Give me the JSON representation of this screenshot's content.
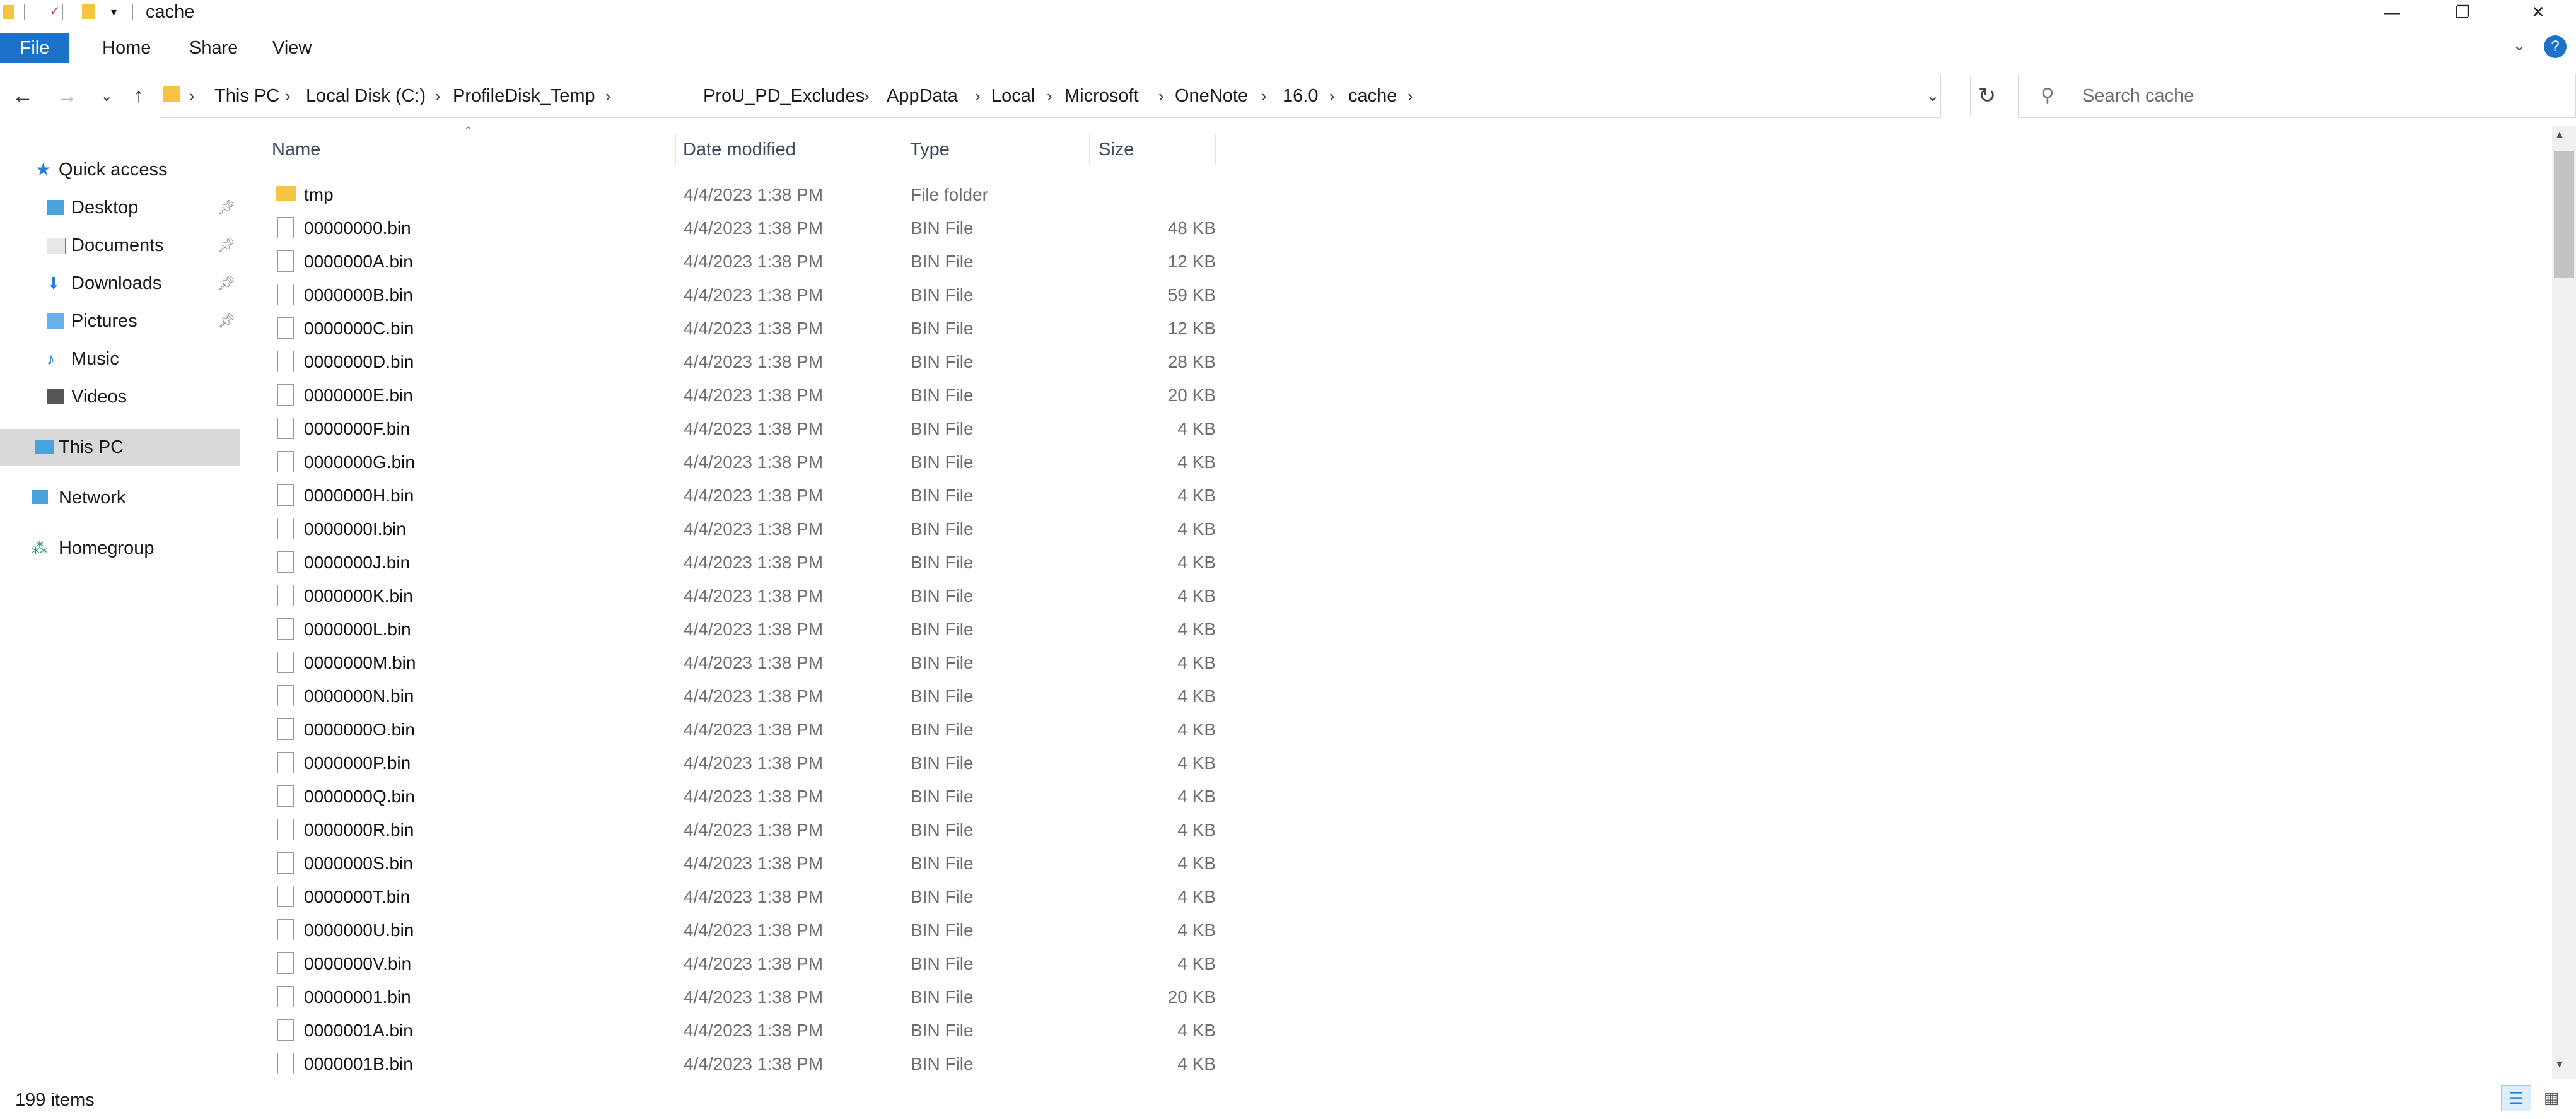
{
  "window": {
    "title": "cache",
    "minimize_icon": "minimize-icon",
    "restore_icon": "restore-icon",
    "close_icon": "close-icon"
  },
  "ribbon": {
    "file": "File",
    "tabs": [
      "Home",
      "Share",
      "View"
    ]
  },
  "address": {
    "breadcrumbs": [
      "This PC",
      "Local Disk (C:)",
      "ProfileDisk_Temp",
      "ProU_PD_Excludes",
      "AppData",
      "Local",
      "Microsoft",
      "OneNote",
      "16.0",
      "cache"
    ],
    "search_placeholder": "Search cache"
  },
  "nav": {
    "quick_access": "Quick access",
    "items": [
      {
        "label": "Desktop",
        "pinned": true
      },
      {
        "label": "Documents",
        "pinned": true
      },
      {
        "label": "Downloads",
        "pinned": true
      },
      {
        "label": "Pictures",
        "pinned": true
      },
      {
        "label": "Music",
        "pinned": false
      },
      {
        "label": "Videos",
        "pinned": false
      }
    ],
    "this_pc": "This PC",
    "network": "Network",
    "homegroup": "Homegroup"
  },
  "columns": {
    "name": "Name",
    "date": "Date modified",
    "type": "Type",
    "size": "Size"
  },
  "files": [
    {
      "name": "tmp",
      "date": "4/4/2023 1:38 PM",
      "type": "File folder",
      "size": ""
    },
    {
      "name": "00000000.bin",
      "date": "4/4/2023 1:38 PM",
      "type": "BIN File",
      "size": "48 KB"
    },
    {
      "name": "0000000A.bin",
      "date": "4/4/2023 1:38 PM",
      "type": "BIN File",
      "size": "12 KB"
    },
    {
      "name": "0000000B.bin",
      "date": "4/4/2023 1:38 PM",
      "type": "BIN File",
      "size": "59 KB"
    },
    {
      "name": "0000000C.bin",
      "date": "4/4/2023 1:38 PM",
      "type": "BIN File",
      "size": "12 KB"
    },
    {
      "name": "0000000D.bin",
      "date": "4/4/2023 1:38 PM",
      "type": "BIN File",
      "size": "28 KB"
    },
    {
      "name": "0000000E.bin",
      "date": "4/4/2023 1:38 PM",
      "type": "BIN File",
      "size": "20 KB"
    },
    {
      "name": "0000000F.bin",
      "date": "4/4/2023 1:38 PM",
      "type": "BIN File",
      "size": "4 KB"
    },
    {
      "name": "0000000G.bin",
      "date": "4/4/2023 1:38 PM",
      "type": "BIN File",
      "size": "4 KB"
    },
    {
      "name": "0000000H.bin",
      "date": "4/4/2023 1:38 PM",
      "type": "BIN File",
      "size": "4 KB"
    },
    {
      "name": "0000000I.bin",
      "date": "4/4/2023 1:38 PM",
      "type": "BIN File",
      "size": "4 KB"
    },
    {
      "name": "0000000J.bin",
      "date": "4/4/2023 1:38 PM",
      "type": "BIN File",
      "size": "4 KB"
    },
    {
      "name": "0000000K.bin",
      "date": "4/4/2023 1:38 PM",
      "type": "BIN File",
      "size": "4 KB"
    },
    {
      "name": "0000000L.bin",
      "date": "4/4/2023 1:38 PM",
      "type": "BIN File",
      "size": "4 KB"
    },
    {
      "name": "0000000M.bin",
      "date": "4/4/2023 1:38 PM",
      "type": "BIN File",
      "size": "4 KB"
    },
    {
      "name": "0000000N.bin",
      "date": "4/4/2023 1:38 PM",
      "type": "BIN File",
      "size": "4 KB"
    },
    {
      "name": "0000000O.bin",
      "date": "4/4/2023 1:38 PM",
      "type": "BIN File",
      "size": "4 KB"
    },
    {
      "name": "0000000P.bin",
      "date": "4/4/2023 1:38 PM",
      "type": "BIN File",
      "size": "4 KB"
    },
    {
      "name": "0000000Q.bin",
      "date": "4/4/2023 1:38 PM",
      "type": "BIN File",
      "size": "4 KB"
    },
    {
      "name": "0000000R.bin",
      "date": "4/4/2023 1:38 PM",
      "type": "BIN File",
      "size": "4 KB"
    },
    {
      "name": "0000000S.bin",
      "date": "4/4/2023 1:38 PM",
      "type": "BIN File",
      "size": "4 KB"
    },
    {
      "name": "0000000T.bin",
      "date": "4/4/2023 1:38 PM",
      "type": "BIN File",
      "size": "4 KB"
    },
    {
      "name": "0000000U.bin",
      "date": "4/4/2023 1:38 PM",
      "type": "BIN File",
      "size": "4 KB"
    },
    {
      "name": "0000000V.bin",
      "date": "4/4/2023 1:38 PM",
      "type": "BIN File",
      "size": "4 KB"
    },
    {
      "name": "00000001.bin",
      "date": "4/4/2023 1:38 PM",
      "type": "BIN File",
      "size": "20 KB"
    },
    {
      "name": "0000001A.bin",
      "date": "4/4/2023 1:38 PM",
      "type": "BIN File",
      "size": "4 KB"
    },
    {
      "name": "0000001B.bin",
      "date": "4/4/2023 1:38 PM",
      "type": "BIN File",
      "size": "4 KB"
    }
  ],
  "status": {
    "item_count": "199 items"
  },
  "colors": {
    "accent": "#1a73c8",
    "selected_nav": "#d9d9d9",
    "folder": "#f5c542"
  }
}
